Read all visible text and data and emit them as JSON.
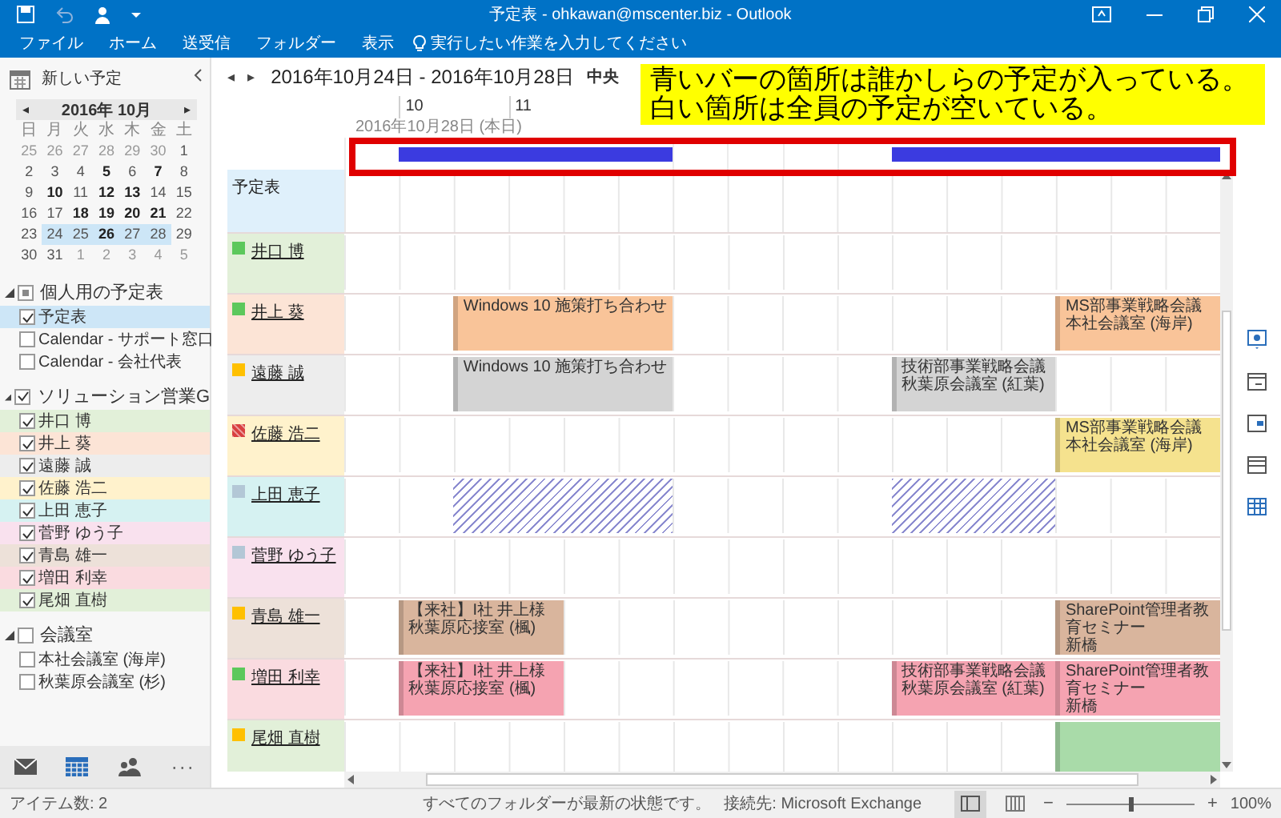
{
  "window": {
    "title": "予定表 - ohkawan@mscenter.biz - Outlook"
  },
  "ribbon": {
    "tabs": [
      "ファイル",
      "ホーム",
      "送受信",
      "フォルダー",
      "表示"
    ],
    "tell_me": "実行したい作業を入力してください"
  },
  "sidebar": {
    "new_item": "新しい予定",
    "mini_calendar": {
      "prev": "◂",
      "month": "2016年 10月",
      "next": "▸",
      "weekdays": [
        "日",
        "月",
        "火",
        "水",
        "木",
        "金",
        "土"
      ],
      "weeks": [
        [
          {
            "d": "25",
            "other": true,
            "bold": false,
            "selected": false
          },
          {
            "d": "26",
            "other": true,
            "bold": false,
            "selected": false
          },
          {
            "d": "27",
            "other": true,
            "bold": false,
            "selected": false
          },
          {
            "d": "28",
            "other": true,
            "bold": false,
            "selected": false
          },
          {
            "d": "29",
            "other": true,
            "bold": false,
            "selected": false
          },
          {
            "d": "30",
            "other": true,
            "bold": false,
            "selected": false
          },
          {
            "d": "1",
            "other": false,
            "bold": false,
            "selected": false
          }
        ],
        [
          {
            "d": "2",
            "other": false,
            "bold": false,
            "selected": false
          },
          {
            "d": "3",
            "other": false,
            "bold": false,
            "selected": false
          },
          {
            "d": "4",
            "other": false,
            "bold": false,
            "selected": false
          },
          {
            "d": "5",
            "other": false,
            "bold": true,
            "selected": false
          },
          {
            "d": "6",
            "other": false,
            "bold": false,
            "selected": false
          },
          {
            "d": "7",
            "other": false,
            "bold": true,
            "selected": false
          },
          {
            "d": "8",
            "other": false,
            "bold": false,
            "selected": false
          }
        ],
        [
          {
            "d": "9",
            "other": false,
            "bold": false,
            "selected": false
          },
          {
            "d": "10",
            "other": false,
            "bold": true,
            "selected": false
          },
          {
            "d": "11",
            "other": false,
            "bold": false,
            "selected": false
          },
          {
            "d": "12",
            "other": false,
            "bold": true,
            "selected": false
          },
          {
            "d": "13",
            "other": false,
            "bold": true,
            "selected": false
          },
          {
            "d": "14",
            "other": false,
            "bold": false,
            "selected": false
          },
          {
            "d": "15",
            "other": false,
            "bold": false,
            "selected": false
          }
        ],
        [
          {
            "d": "16",
            "other": false,
            "bold": false,
            "selected": false
          },
          {
            "d": "17",
            "other": false,
            "bold": false,
            "selected": false
          },
          {
            "d": "18",
            "other": false,
            "bold": true,
            "selected": false
          },
          {
            "d": "19",
            "other": false,
            "bold": true,
            "selected": false
          },
          {
            "d": "20",
            "other": false,
            "bold": true,
            "selected": false
          },
          {
            "d": "21",
            "other": false,
            "bold": true,
            "selected": false
          },
          {
            "d": "22",
            "other": false,
            "bold": false,
            "selected": false
          }
        ],
        [
          {
            "d": "23",
            "other": false,
            "bold": false,
            "selected": false
          },
          {
            "d": "24",
            "other": false,
            "bold": false,
            "selected": true
          },
          {
            "d": "25",
            "other": false,
            "bold": false,
            "selected": true
          },
          {
            "d": "26",
            "other": false,
            "bold": true,
            "selected": true
          },
          {
            "d": "27",
            "other": false,
            "bold": false,
            "selected": true
          },
          {
            "d": "28",
            "other": false,
            "bold": false,
            "selected": true
          },
          {
            "d": "29",
            "other": false,
            "bold": false,
            "selected": false
          }
        ],
        [
          {
            "d": "30",
            "other": false,
            "bold": false,
            "selected": false
          },
          {
            "d": "31",
            "other": false,
            "bold": false,
            "selected": false
          },
          {
            "d": "1",
            "other": true,
            "bold": false,
            "selected": false
          },
          {
            "d": "2",
            "other": true,
            "bold": false,
            "selected": false
          },
          {
            "d": "3",
            "other": true,
            "bold": false,
            "selected": false
          },
          {
            "d": "4",
            "other": true,
            "bold": false,
            "selected": false
          },
          {
            "d": "5",
            "other": true,
            "bold": false,
            "selected": false
          }
        ]
      ]
    },
    "groups": [
      {
        "name": "個人用の予定表",
        "expanded": true,
        "mixed": true,
        "items": [
          {
            "name": "予定表",
            "checked": true,
            "selected": true
          },
          {
            "name": "Calendar - サポート窓口",
            "checked": false,
            "selected": false
          },
          {
            "name": "Calendar - 会社代表",
            "checked": false,
            "selected": false
          }
        ]
      },
      {
        "name": "ソリューション営業G",
        "expanded": true,
        "checked": true,
        "items": [
          {
            "name": "井口 博",
            "checked": true,
            "selected": false,
            "color": "#e2f0d9"
          },
          {
            "name": "井上 葵",
            "checked": true,
            "selected": false,
            "color": "#fce4d6"
          },
          {
            "name": "遠藤 誠",
            "checked": true,
            "selected": false,
            "color": "#ededed"
          },
          {
            "name": "佐藤 浩二",
            "checked": true,
            "selected": false,
            "color": "#fff2cc"
          },
          {
            "name": "上田 恵子",
            "checked": true,
            "selected": false,
            "color": "#d6f2f2"
          },
          {
            "name": "菅野 ゆう子",
            "checked": true,
            "selected": false,
            "color": "#f9e1ee"
          },
          {
            "name": "青島 雄一",
            "checked": true,
            "selected": false,
            "color": "#ede1d9"
          },
          {
            "name": "増田 利幸",
            "checked": true,
            "selected": false,
            "color": "#fadbe0"
          },
          {
            "name": "尾畑 直樹",
            "checked": true,
            "selected": false,
            "color": "#e2f0d9"
          }
        ]
      },
      {
        "name": "会議室",
        "expanded": true,
        "checked": false,
        "items": [
          {
            "name": "本社会議室 (海岸)",
            "checked": false,
            "selected": false
          },
          {
            "name": "秋葉原会議室 (杉)",
            "checked": false,
            "selected": false
          }
        ]
      }
    ],
    "nav": [
      {
        "kind": "mail",
        "selected": false
      },
      {
        "kind": "calendar",
        "selected": true
      },
      {
        "kind": "people",
        "selected": false
      },
      {
        "kind": "more",
        "label": "···",
        "selected": false
      }
    ]
  },
  "schedule": {
    "prev": "◂",
    "next": "▸",
    "range": "2016年10月24日 - 2016年10月28日",
    "timezone": "中央",
    "hour_labels": [
      "10",
      "11"
    ],
    "date": "2016年10月28日 (本日)",
    "columns": [
      {
        "busy": false
      },
      {
        "busy": true
      },
      {
        "busy": true
      },
      {
        "busy": true
      },
      {
        "busy": true
      },
      {
        "busy": true
      },
      {
        "busy": false
      },
      {
        "busy": false
      },
      {
        "busy": false
      },
      {
        "busy": false
      },
      {
        "busy": true
      },
      {
        "busy": true
      },
      {
        "busy": true
      },
      {
        "busy": true
      },
      {
        "busy": true
      },
      {
        "busy": true
      }
    ],
    "calendar_row": "予定表",
    "people": [
      {
        "name": "井口 博",
        "color": "#e2f0d9",
        "marker": {
          "color": "#5cc85c",
          "hatched": false
        },
        "segments": [
          {
            "kind": "free",
            "halves": [
              true,
              true,
              true,
              true
            ]
          },
          {
            "kind": "free",
            "halves": [
              true,
              true,
              true,
              true
            ]
          },
          {
            "kind": "free",
            "halves": [
              true,
              true,
              true,
              true
            ]
          },
          {
            "kind": "free",
            "halves": [
              true,
              true,
              true,
              true
            ]
          }
        ]
      },
      {
        "name": "井上 葵",
        "color": "#fce4d6",
        "marker": {
          "color": "#5cc85c",
          "hatched": false
        },
        "appointment": {
          "color": "#f9c499"
        },
        "segments": [
          {
            "kind": "free",
            "halves": [
              true,
              true
            ]
          },
          {
            "kind": "busy",
            "halves": [
              true,
              true,
              true,
              true
            ],
            "title": "Windows 10 施策打ち合わせ"
          },
          {
            "kind": "free",
            "halves": [
              true,
              true,
              true,
              true
            ]
          },
          {
            "kind": "free",
            "halves": [
              true,
              true,
              true
            ]
          },
          {
            "kind": "busy",
            "halves": [
              true,
              true,
              true
            ],
            "title": "MS部事業戦略会議",
            "location": "本社会議室 (海岸)"
          }
        ]
      },
      {
        "name": "遠藤 誠",
        "color": "#ededed",
        "marker": {
          "color": "#ffc000",
          "hatched": false
        },
        "appointment": {
          "color": "#d4d4d4"
        },
        "segments": [
          {
            "kind": "free",
            "halves": [
              true,
              true
            ]
          },
          {
            "kind": "busy",
            "halves": [
              true,
              true,
              true,
              true
            ],
            "title": "Windows 10 施策打ち合わせ"
          },
          {
            "kind": "free",
            "halves": [
              true,
              true,
              true,
              true
            ]
          },
          {
            "kind": "busy",
            "halves": [
              true,
              true,
              true
            ],
            "title": "技術部事業戦略会議",
            "location": "秋葉原会議室 (紅葉)"
          },
          {
            "kind": "free",
            "halves": [
              true,
              true,
              true
            ]
          }
        ]
      },
      {
        "name": "佐藤 浩二",
        "color": "#fff2cc",
        "marker": {
          "color": "#d94040",
          "hatched": true
        },
        "appointment": {
          "color": "#f5e28e"
        },
        "segments": [
          {
            "kind": "free",
            "halves": [
              true,
              true,
              true,
              true
            ]
          },
          {
            "kind": "free",
            "halves": [
              true,
              true,
              true,
              true
            ]
          },
          {
            "kind": "free",
            "halves": [
              true,
              true,
              true,
              true,
              true
            ]
          },
          {
            "kind": "busy",
            "halves": [
              true,
              true,
              true
            ],
            "title": "MS部事業戦略会議",
            "location": "本社会議室 (海岸)"
          }
        ]
      },
      {
        "name": "上田 恵子",
        "color": "#d6f2f2",
        "marker": {
          "color": "#b3c7d6",
          "hatched": false
        },
        "segments": [
          {
            "kind": "free",
            "halves": [
              true,
              true
            ]
          },
          {
            "kind": "tentative",
            "halves": [
              true,
              true,
              true,
              true
            ]
          },
          {
            "kind": "free",
            "halves": [
              true,
              true,
              true,
              true
            ]
          },
          {
            "kind": "tentative",
            "halves": [
              true,
              true,
              true
            ]
          },
          {
            "kind": "free",
            "halves": [
              true,
              true,
              true
            ]
          }
        ]
      },
      {
        "name": "菅野 ゆう子",
        "color": "#f9e1ee",
        "marker": {
          "color": "#b3c7d6",
          "hatched": false
        },
        "segments": [
          {
            "kind": "free",
            "halves": [
              true,
              true,
              true,
              true
            ]
          },
          {
            "kind": "free",
            "halves": [
              true,
              true,
              true,
              true
            ]
          },
          {
            "kind": "free",
            "halves": [
              true,
              true,
              true,
              true
            ]
          },
          {
            "kind": "free",
            "halves": [
              true,
              true,
              true,
              true
            ]
          }
        ]
      },
      {
        "name": "青島 雄一",
        "color": "#ede1d9",
        "marker": {
          "color": "#ffc000",
          "hatched": false
        },
        "appointment": {
          "color": "#d9b59d"
        },
        "segments": [
          {
            "kind": "free",
            "halves": [
              true
            ]
          },
          {
            "kind": "busy",
            "halves": [
              true,
              true,
              true
            ],
            "title": "【来社】I社 井上様",
            "location": "秋葉原応接室 (楓)"
          },
          {
            "kind": "free",
            "halves": [
              true,
              true,
              true,
              true
            ]
          },
          {
            "kind": "free",
            "halves": [
              true,
              true,
              true,
              true,
              true
            ]
          },
          {
            "kind": "busy",
            "halves": [
              true,
              true,
              true
            ],
            "title": "SharePoint管理者教育セミナー",
            "location": "新橋"
          }
        ]
      },
      {
        "name": "増田 利幸",
        "color": "#fadbe0",
        "marker": {
          "color": "#5cc85c",
          "hatched": false
        },
        "appointment": {
          "color": "#f5a3b1"
        },
        "segments": [
          {
            "kind": "free",
            "halves": [
              true
            ]
          },
          {
            "kind": "busy",
            "halves": [
              true,
              true,
              true
            ],
            "title": "【来社】I社 井上様",
            "location": "秋葉原応接室 (楓)"
          },
          {
            "kind": "free",
            "halves": [
              true,
              true,
              true,
              true,
              true,
              true
            ]
          },
          {
            "kind": "busy",
            "halves": [
              true,
              true,
              true
            ],
            "title": "技術部事業戦略会議",
            "location": "秋葉原会議室 (紅葉)"
          },
          {
            "kind": "busy",
            "halves": [
              true,
              true,
              true
            ],
            "title": "SharePoint管理者教育セミナー",
            "location": "新橋"
          }
        ]
      },
      {
        "name": "尾畑 直樹",
        "color": "#e2f0d9",
        "marker": {
          "color": "#ffc000",
          "hatched": false
        },
        "appointment": {
          "color": "#a9dba9"
        },
        "segments": [
          {
            "kind": "free",
            "halves": [
              true,
              true,
              true,
              true
            ]
          },
          {
            "kind": "free",
            "halves": [
              true,
              true,
              true,
              true
            ]
          },
          {
            "kind": "free",
            "halves": [
              true,
              true,
              true,
              true,
              true
            ]
          },
          {
            "kind": "busy",
            "halves": [
              true,
              true,
              true
            ]
          }
        ]
      }
    ]
  },
  "annotation": {
    "lines": [
      "青いバーの箇所は誰かしらの予定が入っている。",
      "白い箇所は全員の予定が空いている。"
    ],
    "highlight_busy_row": true
  },
  "status_bar": {
    "items": "アイテム数: 2",
    "sync": "すべてのフォルダーが最新の状態です。",
    "connection": "接続先: Microsoft Exchange",
    "views": [
      {
        "kind": "normal",
        "selected": true
      },
      {
        "kind": "reading",
        "selected": false
      }
    ],
    "zoom": {
      "minus": "−",
      "plus": "+",
      "level": 0.5,
      "reading": "100%"
    }
  }
}
